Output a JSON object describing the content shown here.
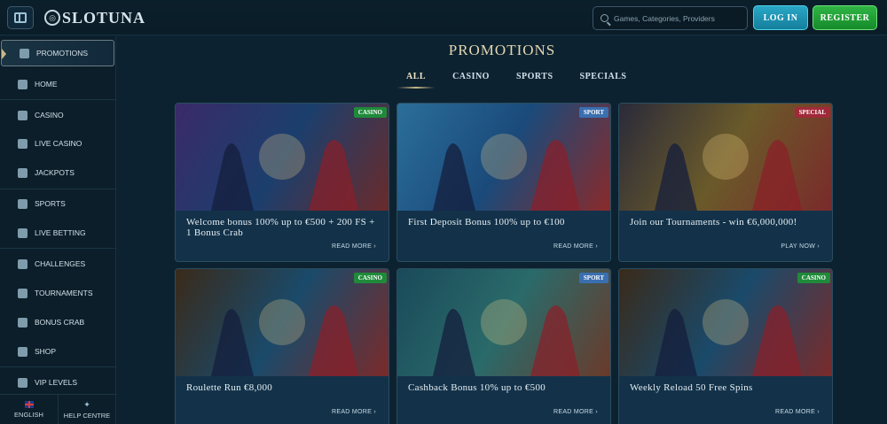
{
  "header": {
    "brand": "SLOTUNA",
    "search_placeholder": "Games, Categories, Providers",
    "login_label": "LOG IN",
    "register_label": "REGISTER"
  },
  "sidebar": {
    "items": [
      {
        "label": "PROMOTIONS",
        "icon": "chest-icon",
        "active": true
      },
      {
        "label": "HOME",
        "icon": "castle-icon"
      },
      {
        "label": "CASINO",
        "icon": "slot-machine-icon"
      },
      {
        "label": "LIVE CASINO",
        "icon": "cards-icon"
      },
      {
        "label": "JACKPOTS",
        "icon": "coins-icon"
      },
      {
        "label": "SPORTS",
        "icon": "football-icon"
      },
      {
        "label": "LIVE BETTING",
        "icon": "chart-icon"
      },
      {
        "label": "CHALLENGES",
        "icon": "medal-icon"
      },
      {
        "label": "TOURNAMENTS",
        "icon": "trophy-icon"
      },
      {
        "label": "BONUS CRAB",
        "icon": "crab-icon"
      },
      {
        "label": "SHOP",
        "icon": "shop-icon"
      },
      {
        "label": "VIP LEVELS",
        "icon": "diamond-icon"
      }
    ],
    "footer": {
      "language_label": "ENGLISH",
      "help_label": "HELP CENTRE"
    }
  },
  "main": {
    "title": "PROMOTIONS",
    "tabs": [
      "ALL",
      "CASINO",
      "SPORTS",
      "SPECIALS"
    ],
    "active_tab": "ALL",
    "cards": [
      {
        "badge": "CASINO",
        "badge_color": "#1f8a3a",
        "title": "Welcome bonus 100% up to €500 + 200 FS + 1 Bonus Crab",
        "link": "READ MORE ›",
        "theme": [
          "#3a2a6a",
          "#1b3f6d",
          "#6a2a2a"
        ]
      },
      {
        "badge": "SPORT",
        "badge_color": "#3a6fb0",
        "title": "First Deposit Bonus 100% up to €100",
        "link": "READ MORE ›",
        "theme": [
          "#2b6e9a",
          "#1a4a7a",
          "#8a2a2a"
        ]
      },
      {
        "badge": "SPECIAL",
        "badge_color": "#a02a3a",
        "title": "Join our Tournaments - win €6,000,000!",
        "link": "PLAY NOW ›",
        "theme": [
          "#2a2a3a",
          "#6a5a2a",
          "#7a2a2a"
        ]
      },
      {
        "badge": "CASINO",
        "badge_color": "#1f8a3a",
        "title": "Roulette Run €8,000",
        "link": "READ MORE ›",
        "theme": [
          "#3a2a1a",
          "#1a4a6a",
          "#7a2a2a"
        ]
      },
      {
        "badge": "SPORT",
        "badge_color": "#3a6fb0",
        "title": "Cashback Bonus 10% up to €500",
        "link": "READ MORE ›",
        "theme": [
          "#1a4a5a",
          "#2a6a6a",
          "#6a3a2a"
        ]
      },
      {
        "badge": "CASINO",
        "badge_color": "#1f8a3a",
        "title": "Weekly Reload 50 Free Spins",
        "link": "READ MORE ›",
        "theme": [
          "#3a2a1a",
          "#1a4a6a",
          "#7a2a2a"
        ]
      }
    ]
  }
}
